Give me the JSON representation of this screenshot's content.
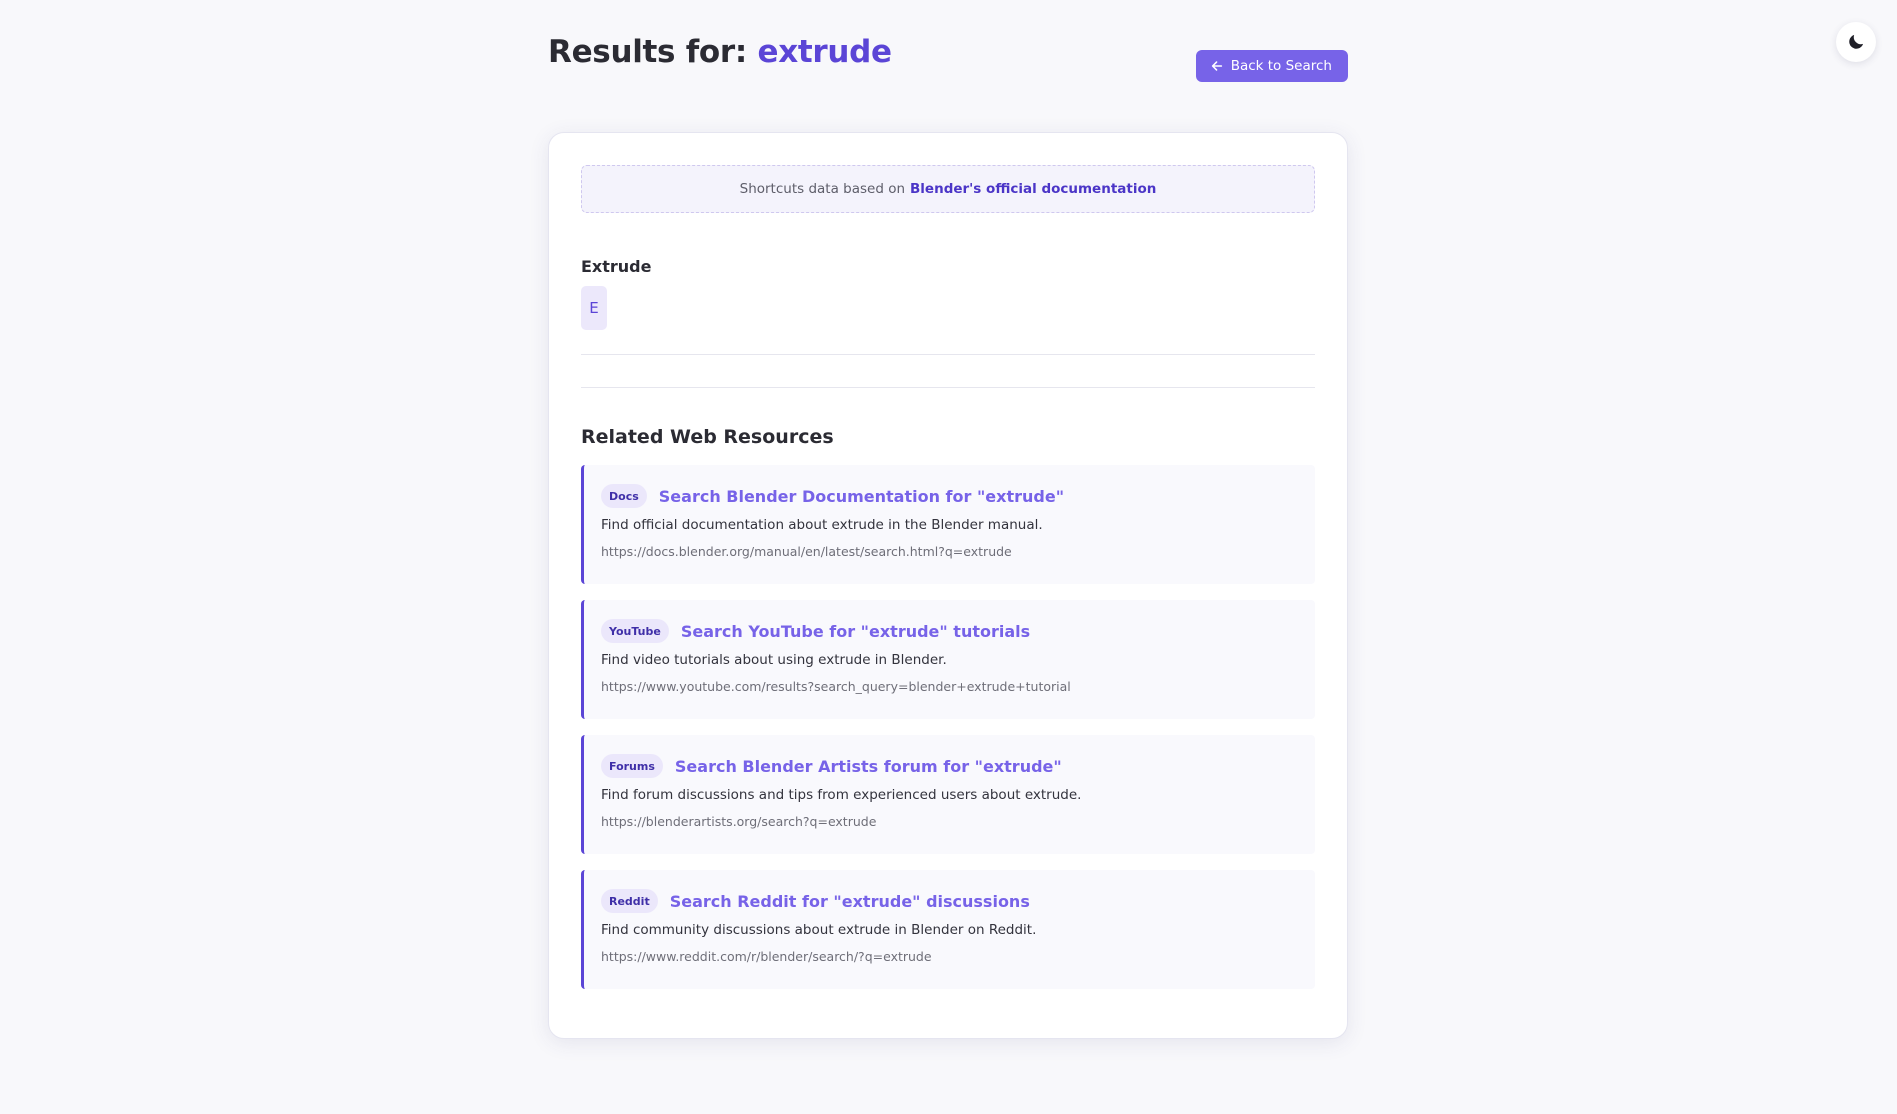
{
  "header": {
    "title_prefix": "Results for: ",
    "query": "extrude",
    "back_button_label": "Back to Search",
    "theme_toggle_icon": "moon-icon"
  },
  "source_note": {
    "text": "Shortcuts data based on",
    "link_text": "Blender's official documentation"
  },
  "shortcut": {
    "name": "Extrude",
    "keys": [
      "E"
    ]
  },
  "resources": {
    "title": "Related Web Resources",
    "items": [
      {
        "badge": "Docs",
        "title": "Search Blender Documentation for \"extrude\"",
        "description": "Find official documentation about extrude in the Blender manual.",
        "url": "https://docs.blender.org/manual/en/latest/search.html?q=extrude"
      },
      {
        "badge": "YouTube",
        "title": "Search YouTube for \"extrude\" tutorials",
        "description": "Find video tutorials about using extrude in Blender.",
        "url": "https://www.youtube.com/results?search_query=blender+extrude+tutorial"
      },
      {
        "badge": "Forums",
        "title": "Search Blender Artists forum for \"extrude\"",
        "description": "Find forum discussions and tips from experienced users about extrude.",
        "url": "https://blenderartists.org/search?q=extrude"
      },
      {
        "badge": "Reddit",
        "title": "Search Reddit for \"extrude\" discussions",
        "description": "Find community discussions about extrude in Blender on Reddit.",
        "url": "https://www.reddit.com/r/blender/search/?q=extrude"
      }
    ]
  },
  "colors": {
    "accent": "#5b45d6",
    "accent_light": "#7763e8",
    "page_background": "#f8f8fb"
  }
}
